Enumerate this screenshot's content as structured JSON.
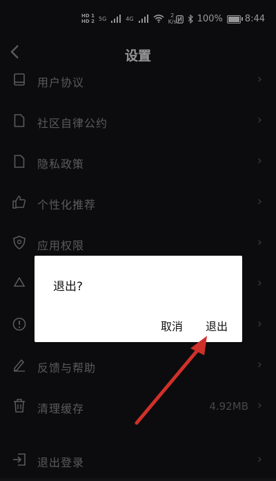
{
  "status_bar": {
    "hd1": "HD 1",
    "hd2": "HD 2",
    "signal1": "5G",
    "signal2": "4G",
    "net_speed_value": "2",
    "net_speed_unit": "K/s",
    "battery": "100%",
    "time": "8:44",
    "icons": [
      "nfc-icon",
      "bluetooth-icon",
      "battery-icon",
      "wifi-icon",
      "signal-icon"
    ]
  },
  "header": {
    "title": "设置",
    "back_icon": "chevron-left-icon"
  },
  "menu": {
    "items": [
      {
        "label": "用户协议",
        "icon": "book-icon"
      },
      {
        "label": "社区自律公约",
        "icon": "document-icon"
      },
      {
        "label": "隐私政策",
        "icon": "document-icon"
      },
      {
        "label": "个性化推荐",
        "icon": "thumbs-up-icon"
      },
      {
        "label": "应用权限",
        "icon": "shield-icon"
      },
      {
        "label": "",
        "icon": "recycle-icon"
      },
      {
        "label": "",
        "icon": "info-icon"
      },
      {
        "label": "反馈与帮助",
        "icon": "pencil-icon"
      },
      {
        "label": "清理缓存",
        "icon": "trash-icon",
        "value": "4.92MB"
      },
      {
        "label": "退出登录",
        "icon": "logout-icon"
      }
    ]
  },
  "dialog": {
    "message": "退出?",
    "cancel_label": "取消",
    "confirm_label": "退出"
  },
  "colors": {
    "background": "#131316",
    "dialog": "#ffffff",
    "arrow": "#d0302a"
  }
}
